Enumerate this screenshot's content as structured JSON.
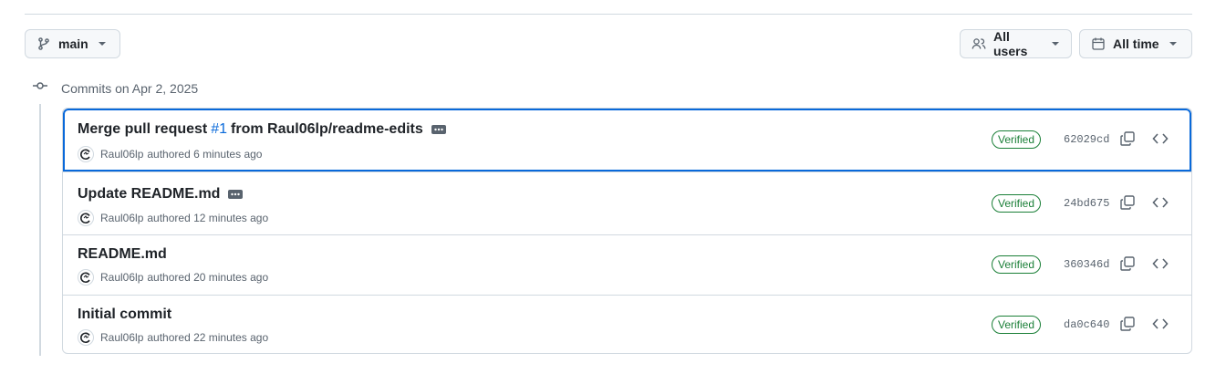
{
  "toolbar": {
    "branch_label": "main",
    "users_label": "All users",
    "time_label": "All time"
  },
  "group": {
    "title": "Commits on Apr 2, 2025"
  },
  "commits": [
    {
      "title_prefix": "Merge pull request",
      "pr_link": "#1",
      "title_suffix": "from Raul06lp/readme-edits",
      "has_ellipsis": true,
      "author": "Raul06lp",
      "time": "authored 6 minutes ago",
      "badge": "Verified",
      "sha": "62029cd"
    },
    {
      "title": "Update README.md",
      "has_ellipsis": true,
      "author": "Raul06lp",
      "time": "authored 12 minutes ago",
      "badge": "Verified",
      "sha": "24bd675"
    },
    {
      "title": "README.md",
      "has_ellipsis": false,
      "author": "Raul06lp",
      "time": "authored 20 minutes ago",
      "badge": "Verified",
      "sha": "360346d"
    },
    {
      "title": "Initial commit",
      "has_ellipsis": false,
      "author": "Raul06lp",
      "time": "authored 22 minutes ago",
      "badge": "Verified",
      "sha": "da0c640"
    }
  ],
  "colors": {
    "accent": "#0969da",
    "verified": "#1a7f37",
    "border": "#d1d9e0",
    "muted": "#59636e"
  }
}
